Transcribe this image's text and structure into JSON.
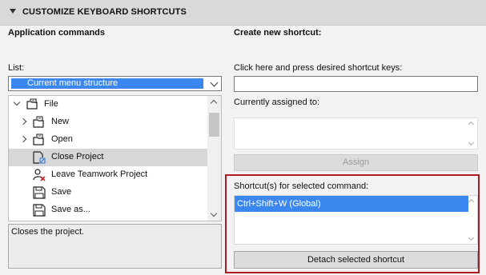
{
  "header": {
    "title": "CUSTOMIZE KEYBOARD SHORTCUTS"
  },
  "left": {
    "section_label": "Application commands",
    "list_label": "List:",
    "list_select_value": "Current menu structure",
    "tree": [
      {
        "label": "File",
        "icon": "folder-open-icon"
      },
      {
        "label": "New",
        "icon": "new-document-icon"
      },
      {
        "label": "Open",
        "icon": "open-document-icon"
      },
      {
        "label": "Close Project",
        "icon": "close-project-icon"
      },
      {
        "label": "Leave Teamwork Project",
        "icon": "leave-teamwork-icon"
      },
      {
        "label": "Save",
        "icon": "floppy-disk-icon"
      },
      {
        "label": "Save as...",
        "icon": "save-as-icon"
      }
    ],
    "description": "Closes the project."
  },
  "right": {
    "section_label": "Create new shortcut:",
    "press_keys_label": "Click here and press desired shortcut keys:",
    "press_keys_value": "",
    "currently_assigned_label": "Currently assigned to:",
    "assign_button": "Assign",
    "selected_shortcuts_label": "Shortcut(s) for selected command:",
    "shortcuts": [
      "Ctrl+Shift+W (Global)"
    ],
    "detach_button": "Detach selected shortcut"
  },
  "colors": {
    "selection_blue": "#3a87f0",
    "highlight_red": "#b01a22",
    "tree_selected": "#d7d7d7"
  }
}
